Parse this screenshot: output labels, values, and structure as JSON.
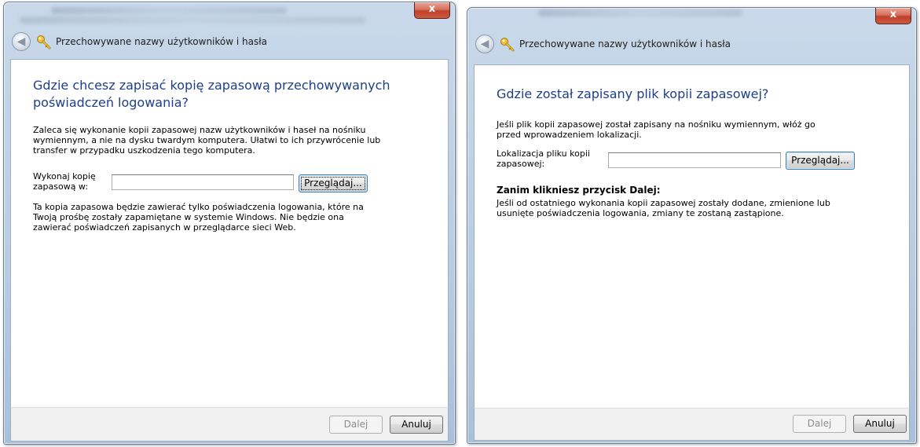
{
  "dialog_left": {
    "title_text": "",
    "close_symbol": "x",
    "nav_title": "Przechowywane nazwy użytkowników i hasła",
    "heading": "Gdzie chcesz zapisać kopię zapasową przechowywanych poświadczeń logowania?",
    "intro": "Zaleca się wykonanie kopii zapasowej nazw użytkowników i haseł na nośniku wymiennym, a nie na dysku twardym komputera. Ułatwi to ich przywrócenie lub transfer w przypadku uszkodzenia tego komputera.",
    "field_label_line1": "Wykonaj kopię",
    "field_label_line2": "zapasową w:",
    "field_value": "",
    "browse_label": "Przeglądaj...",
    "note": "Ta kopia zapasowa będzie zawierać tylko poświadczenia logowania, które na Twoją prośbę zostały zapamiętane w systemie Windows. Nie będzie ona zawierać poświadczeń zapisanych w przeglądarce sieci Web.",
    "next_label": "Dalej",
    "cancel_label": "Anuluj"
  },
  "dialog_right": {
    "close_symbol": "x",
    "nav_title": "Przechowywane nazwy użytkowników i hasła",
    "heading": "Gdzie został zapisany plik kopii zapasowej?",
    "intro": "Jeśli plik kopii zapasowej został zapisany na nośniku wymiennym, włóż go przed wprowadzeniem lokalizacji.",
    "field_label_line1": "Lokalizacja pliku kopii",
    "field_label_line2": "zapasowej:",
    "field_value": "",
    "browse_label": "Przeglądaj...",
    "warning_title": "Zanim klikniesz przycisk Dalej:",
    "warning_text": "Jeśli od ostatniego wykonania kopii zapasowej zostały dodane, zmienione lub usunięte poświadczenia logowania, zmiany te zostaną zastąpione.",
    "next_label": "Dalej",
    "cancel_label": "Anuluj"
  },
  "icons": {
    "back": "back-arrow-icon",
    "key": "key-icon",
    "close": "close-icon"
  },
  "colors": {
    "heading_blue": "#1e3f8a",
    "close_red": "#c0402b",
    "frame_blue": "#b8cce2"
  }
}
